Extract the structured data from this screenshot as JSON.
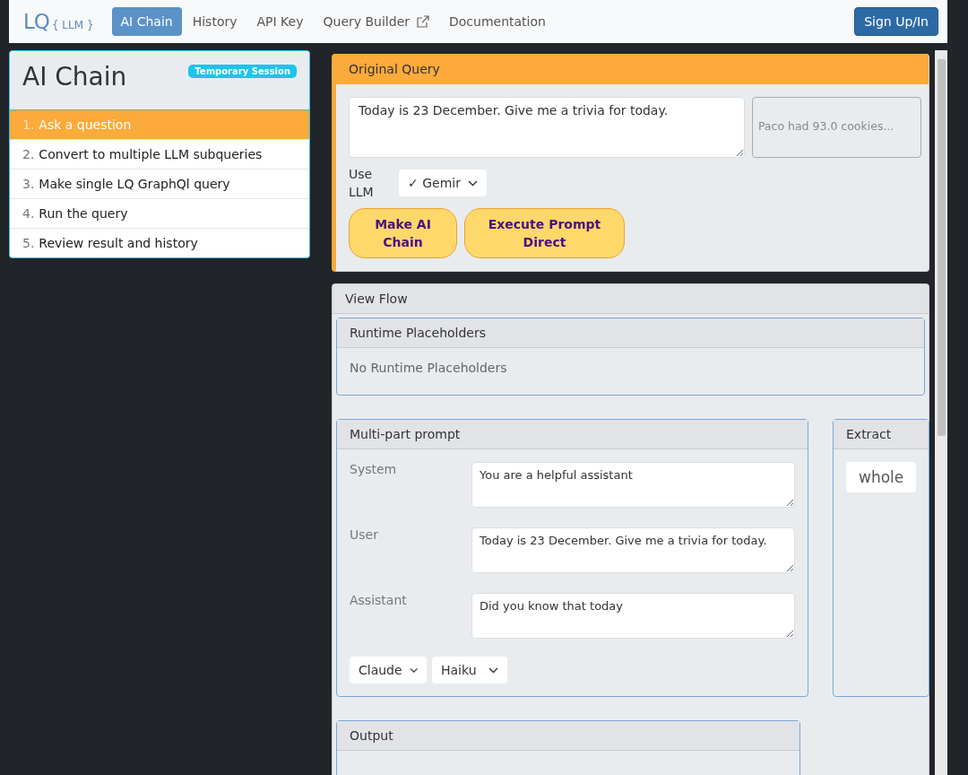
{
  "navbar": {
    "logo": {
      "main": "LQ",
      "sub": "{ LLM }"
    },
    "items": [
      {
        "label": "AI Chain",
        "selected": true,
        "external": false
      },
      {
        "label": "History",
        "selected": false,
        "external": false
      },
      {
        "label": "API Key",
        "selected": false,
        "external": false
      },
      {
        "label": "Query Builder",
        "selected": false,
        "external": true
      },
      {
        "label": "Documentation",
        "selected": false,
        "external": false
      }
    ],
    "signup": "Sign Up/In"
  },
  "sidebar": {
    "title": "AI Chain",
    "badge": "Temporary Session",
    "steps": [
      {
        "number": "1.",
        "label": "Ask a question",
        "selected": true
      },
      {
        "number": "2.",
        "label": "Convert to multiple LLM subqueries",
        "selected": false
      },
      {
        "number": "3.",
        "label": "Make single LQ GraphQl query",
        "selected": false
      },
      {
        "number": "4.",
        "label": "Run the query",
        "selected": false
      },
      {
        "number": "5.",
        "label": "Review result and history",
        "selected": false
      }
    ]
  },
  "query": {
    "header": "Original Query",
    "text": "Today is 23 December. Give me a trivia for today.",
    "placeholder": "Paco had 93.0 cookies...",
    "use_llm_label": "Use LLM",
    "model": "✓ Gemir",
    "buttons": [
      "Make AI Chain",
      "Execute Prompt Direct"
    ]
  },
  "flow": {
    "header": "View Flow",
    "runtime": {
      "header": "Runtime Placeholders",
      "message": "No Runtime Placeholders"
    },
    "multipart": {
      "header": "Multi-part prompt",
      "rows": [
        {
          "role": "System",
          "value": "You are a helpful assistant"
        },
        {
          "role": "User",
          "value": "Today is 23 December. Give me a trivia for today."
        },
        {
          "role": "Assistant",
          "value": "Did you know that today"
        }
      ],
      "selects": [
        "Claude",
        "Haiku"
      ]
    },
    "extract": {
      "header": "Extract",
      "value": "whole"
    },
    "output": {
      "header": "Output"
    }
  }
}
